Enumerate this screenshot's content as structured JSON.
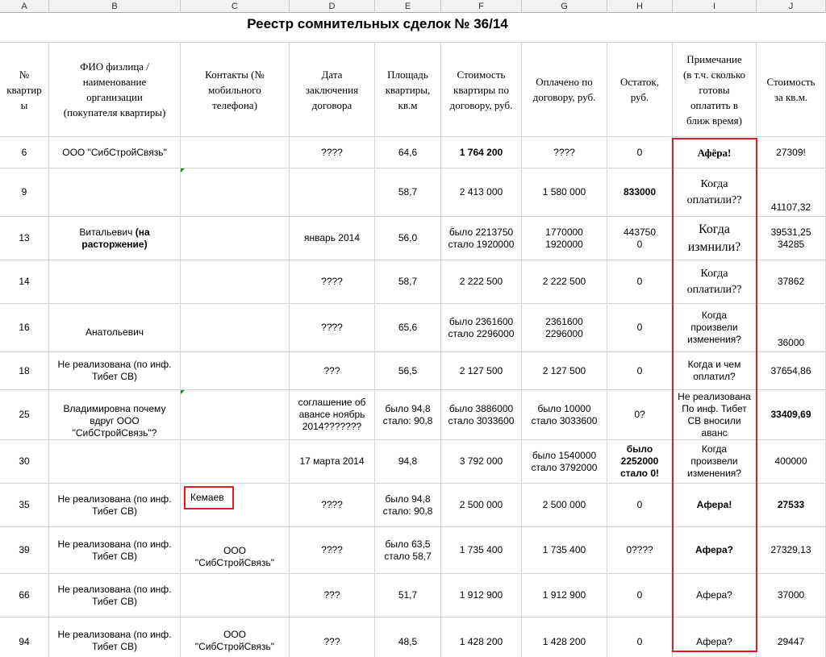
{
  "sheet": {
    "title": "Реестр сомнительных сделок № 36/14",
    "column_letters": [
      "A",
      "B",
      "C",
      "D",
      "E",
      "F",
      "G",
      "H",
      "I",
      "J"
    ],
    "headers": [
      "№\nквартир\nы",
      "ФИО физлица /\nнаименование\nорганизации\n(покупателя квартиры)",
      "Контакты (№\nмобильного\nтелефона)",
      "Дата\nзаключения\nдоговора",
      "Площадь\nквартиры,\nкв.м",
      "Стоимость\nквартиры по\nдоговору, руб.",
      "Оплачено по\nдоговору, руб.",
      "Остаток,\nруб.",
      "Примечание\n(в т.ч. сколько\nготовы\nоплатить в\nближ время)",
      "Стоимость\nза кв.м."
    ],
    "rows": [
      {
        "apt": "6",
        "buyer": "ООО \"СибСтройСвязь\"",
        "contact": "",
        "date": "????",
        "area": "64,6",
        "price": "1 764 200",
        "paid": "????",
        "rest": "0",
        "note": "Афёра!",
        "ppm": "27309!"
      },
      {
        "apt": "9",
        "buyer": "",
        "contact": "",
        "date": "",
        "area": "58,7",
        "price": "2 413 000",
        "paid": "1 580 000",
        "rest": "833000",
        "note": "Когда\nоплатили??",
        "ppm": "41107,32"
      },
      {
        "apt": "13",
        "buyer_pre": "Витальевич ",
        "buyer_bold": "(на\nрасторжение)",
        "contact": "",
        "date": "январь 2014",
        "area": "56,0",
        "price": "было 2213750\nстало 1920000",
        "paid": "1770000\n1920000",
        "rest": "443750\n0",
        "note": "Когда\nизмнили?",
        "ppm": "39531,25\n34285"
      },
      {
        "apt": "14",
        "buyer": "",
        "contact": "",
        "date": "????",
        "area": "58,7",
        "price": "2 222 500",
        "paid": "2 222 500",
        "rest": "0",
        "note": "Когда\nоплатили??",
        "ppm": "37862"
      },
      {
        "apt": "16",
        "buyer": "Анатольевич",
        "contact": "",
        "date": "????",
        "area": "65,6",
        "price": "было 2361600\nстало 2296000",
        "paid": "2361600\n2296000",
        "rest": "0",
        "note": "Когда\nпроизвели\nизменения?",
        "ppm": "36000"
      },
      {
        "apt": "18",
        "buyer": "Не реализована (по инф.\nТибет СВ)",
        "contact": "",
        "date": "???",
        "area": "56,5",
        "price": "2 127 500",
        "paid": "2 127 500",
        "rest": "0",
        "note": "Когда и чем\nоплатил?",
        "ppm": "37654,86"
      },
      {
        "apt": "25",
        "buyer": "Владимировна почему\nвдруг ООО\n\"СибСтройСвязь\"?",
        "contact": "",
        "date": "соглашение об\nавансе ноябрь\n2014???????",
        "area": "было 94,8\nстало: 90,8",
        "price": "было 3886000\nстало 3033600",
        "paid": "было 10000\nстало 3033600",
        "rest": "0?",
        "note": "Не реализована\nПо инф. Тибет\nСВ вносили\nаванс",
        "ppm": "33409,69"
      },
      {
        "apt": "30",
        "buyer": "",
        "contact": "",
        "date": "17 марта 2014",
        "area": "94,8",
        "price": "3 792 000",
        "paid": "было 1540000\nстало 3792000",
        "rest": "было\n2252000\nстало 0!",
        "note": "Когда\nпроизвели\nизменения?",
        "ppm": "400000"
      },
      {
        "apt": "35",
        "buyer": "Не реализована (по инф.\nТибет СВ)",
        "contact": "Кемаев",
        "date": "????",
        "area": "было 94,8\nстало: 90,8",
        "price": "2 500 000",
        "paid": "2 500 000",
        "rest": "0",
        "note": "Афера!",
        "ppm": "27533"
      },
      {
        "apt": "39",
        "buyer": "Не реализована (по инф.\nТибет СВ)",
        "contact": "ООО\n\"СибСтройСвязь\"",
        "date": "????",
        "area": "было 63,5\nстало 58,7",
        "price": "1 735 400",
        "paid": "1 735 400",
        "rest": "0????",
        "note": "Афера?",
        "ppm": "27329,13"
      },
      {
        "apt": "66",
        "buyer": "Не реализована (по инф.\nТибет СВ)",
        "contact": "",
        "date": "???",
        "area": "51,7",
        "price": "1 912 900",
        "paid": "1 912 900",
        "rest": "0",
        "note": "Афера?",
        "ppm": "37000"
      },
      {
        "apt": "94",
        "buyer": "Не реализована (по инф.\nТибет СВ)",
        "contact": "ООО\n\"СибСтройСвязь\"",
        "date": "???",
        "area": "48,5",
        "price": "1 428 200",
        "paid": "1 428 200",
        "rest": "0",
        "note": "Афера?",
        "ppm": "29447"
      }
    ]
  }
}
